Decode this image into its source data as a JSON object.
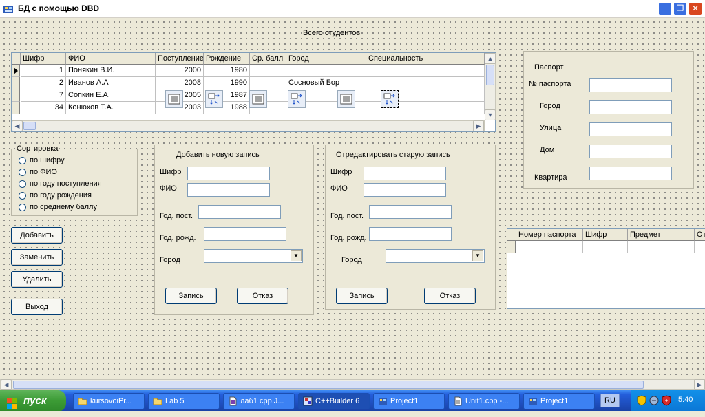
{
  "window": {
    "title": "БД с помощью DBD"
  },
  "total_label": "Всего студентов",
  "students_grid": {
    "columns": [
      "Шифр",
      "ФИО",
      "Поступление",
      "Рождение",
      "Ср. балл",
      "Город",
      "Специальность"
    ],
    "rows": [
      [
        "1",
        "Понякин В.И.",
        "2000",
        "1980",
        "",
        "",
        ""
      ],
      [
        "2",
        "Иванов А.А",
        "2008",
        "1990",
        "",
        "Сосновый Бор",
        ""
      ],
      [
        "7",
        "Сопкин Е.А.",
        "2005",
        "1987",
        "",
        "",
        ""
      ],
      [
        "34",
        "Конюхов Т.А.",
        "2003",
        "1988",
        "",
        "",
        ""
      ]
    ]
  },
  "sort_group": {
    "title": "Сортировка",
    "options": [
      "по шифру",
      "по ФИО",
      "по году поступления",
      "по году рождения",
      "по среднему баллу"
    ]
  },
  "buttons": {
    "add": "Добавить",
    "replace": "Заменить",
    "delete": "Удалить",
    "exit": "Выход"
  },
  "add_panel": {
    "title": "Добавить новую запись",
    "labels": {
      "code": "Шифр",
      "name": "ФИО",
      "year_in": "Год. пост.",
      "year_birth": "Год. рожд.",
      "city": "Город"
    },
    "save": "Запись",
    "cancel": "Отказ"
  },
  "edit_panel": {
    "title": "Отредактировать старую запись",
    "labels": {
      "code": "Шифр",
      "name": "ФИО",
      "year_in": "Год. пост.",
      "year_birth": "Год. рожд.",
      "city": "Город"
    },
    "save": "Запись",
    "cancel": "Отказ"
  },
  "passport_panel": {
    "title": "Паспорт",
    "labels": {
      "number": "№ паспорта",
      "city": "Город",
      "street": "Улица",
      "house": "Дом",
      "flat": "Квартира"
    }
  },
  "grades_grid": {
    "columns": [
      "Номер паспорта",
      "Шифр",
      "Предмет",
      "От"
    ]
  },
  "taskbar": {
    "start": "пуск",
    "tasks": [
      "kursovoiPr...",
      "Lab 5",
      "лаб1 cpp.J...",
      "C++Builder 6",
      "Project1",
      "Unit1.cpp -...",
      "Project1"
    ],
    "lang": "RU",
    "clock": "5:40"
  }
}
